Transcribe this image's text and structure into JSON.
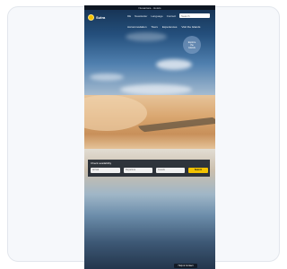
{
  "topbar": {
    "text": "Nusantara - Hotels"
  },
  "logo": {
    "text": "Sutra"
  },
  "utility": {
    "items": [
      "DE",
      "Newsletter",
      "Language",
      "Contact"
    ]
  },
  "search": {
    "placeholder": "Search"
  },
  "nav": {
    "items": [
      "Accommodation",
      "Tours",
      "Experiences",
      "Visit the Islands"
    ]
  },
  "badge": {
    "lines": [
      "Explore",
      "the",
      "islands"
    ]
  },
  "booking": {
    "title": "Check availability",
    "fields": [
      "Arrival",
      "Departure",
      "Guests"
    ],
    "button": "Search"
  },
  "footer": {
    "pill": "Help & Contact"
  }
}
